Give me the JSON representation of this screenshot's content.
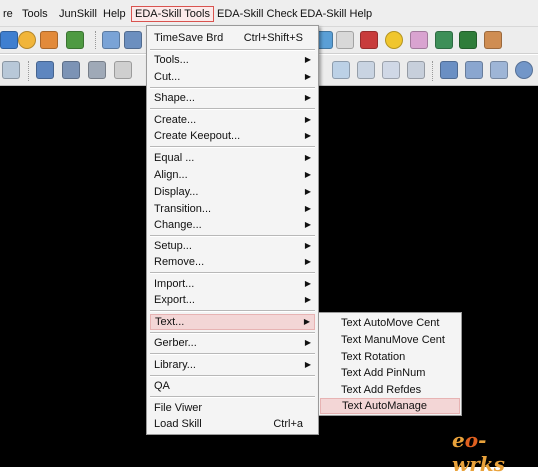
{
  "menubar": {
    "items": [
      {
        "label": "re"
      },
      {
        "label": "Tools"
      },
      {
        "label": "JunSkill"
      },
      {
        "label": "Help"
      },
      {
        "label": "EDA-Skill Tools"
      },
      {
        "label": "EDA-Skill Check"
      },
      {
        "label": "EDA-Skill Help"
      }
    ]
  },
  "dropdown": {
    "items": [
      {
        "label": "TimeSave Brd",
        "shortcut": "Ctrl+Shift+S"
      },
      {
        "label": "Tools...",
        "arrow": "▶"
      },
      {
        "label": "Cut...",
        "arrow": "▶"
      },
      {
        "label": "Shape...",
        "arrow": "▶"
      },
      {
        "label": "Create...",
        "arrow": "▶"
      },
      {
        "label": "Create Keepout...",
        "arrow": "▶"
      },
      {
        "label": "Equal ...",
        "arrow": "▶"
      },
      {
        "label": "Align...",
        "arrow": "▶"
      },
      {
        "label": "Display...",
        "arrow": "▶"
      },
      {
        "label": "Transition...",
        "arrow": "▶"
      },
      {
        "label": "Change...",
        "arrow": "▶"
      },
      {
        "label": "Setup...",
        "arrow": "▶"
      },
      {
        "label": "Remove...",
        "arrow": "▶"
      },
      {
        "label": "Import...",
        "arrow": "▶"
      },
      {
        "label": "Export...",
        "arrow": "▶"
      },
      {
        "label": "Text...",
        "arrow": "▶"
      },
      {
        "label": "Gerber...",
        "arrow": "▶"
      },
      {
        "label": "Library...",
        "arrow": "▶"
      },
      {
        "label": "QA"
      },
      {
        "label": "File Viwer"
      },
      {
        "label": "Load Skill",
        "shortcut": "Ctrl+a"
      }
    ]
  },
  "submenu": {
    "items": [
      {
        "label": "Text AutoMove Cent"
      },
      {
        "label": "Text ManuMove Cent"
      },
      {
        "label": "Text Rotation"
      },
      {
        "label": "Text Add PinNum"
      },
      {
        "label": "Text Add Refdes"
      },
      {
        "label": "Text AutoManage"
      }
    ]
  },
  "watermark": {
    "prefix": "e",
    "highlight": "o",
    "suffix": "-wrks"
  },
  "colors": {
    "menu_active_border": "#d9534f",
    "menu_highlight": "#f3d6d6",
    "canvas": "#000000",
    "watermark": "#e9a23b"
  }
}
